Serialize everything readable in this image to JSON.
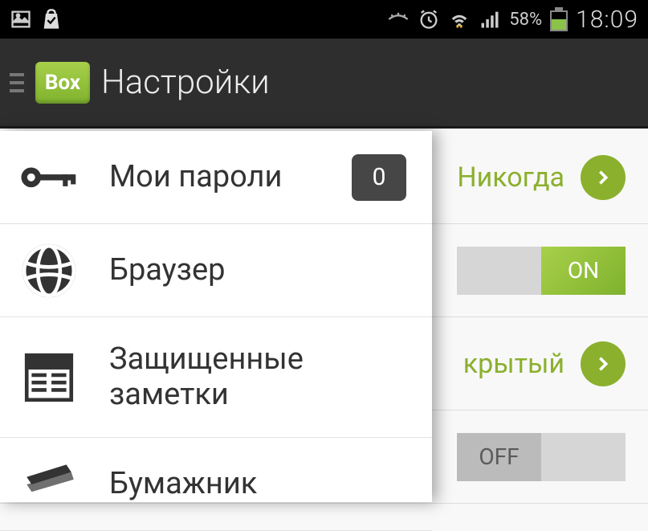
{
  "status": {
    "battery_pct": "58%",
    "clock": "18:09"
  },
  "app": {
    "logo_text": "Box",
    "title": "Настройки"
  },
  "drawer": {
    "items": [
      {
        "label": "Мои пароли",
        "badge": "0"
      },
      {
        "label": "Браузер"
      },
      {
        "label": "Защищенные заметки"
      },
      {
        "label": "Бумажник"
      }
    ]
  },
  "settings": {
    "rows": [
      {
        "value": "Никогда",
        "type": "chevron"
      },
      {
        "value": "ON",
        "type": "toggle",
        "on": true
      },
      {
        "value": "крытый",
        "type": "chevron"
      },
      {
        "value": "OFF",
        "type": "toggle",
        "on": false
      }
    ],
    "toggle_labels": {
      "on": "ON",
      "off": "OFF"
    }
  }
}
